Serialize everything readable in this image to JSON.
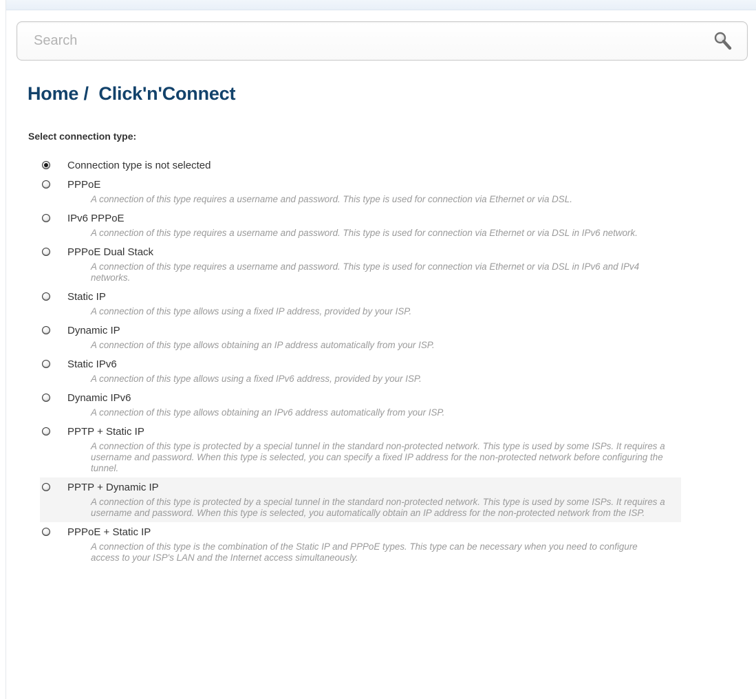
{
  "search": {
    "placeholder": "Search"
  },
  "breadcrumb": "Home /  Click'n'Connect",
  "section_label": "Select connection type:",
  "options": [
    {
      "label": "Connection type is not selected",
      "description": "",
      "checked": true
    },
    {
      "label": "PPPoE",
      "description": "A connection of this type requires a username and password. This type is used for connection via Ethernet or via DSL.",
      "checked": false
    },
    {
      "label": "IPv6 PPPoE",
      "description": "A connection of this type requires a username and password. This type is used for connection via Ethernet or via DSL in IPv6 network.",
      "checked": false
    },
    {
      "label": "PPPoE Dual Stack",
      "description": "A connection of this type requires a username and password. This type is used for connection via Ethernet or via DSL in IPv6 and IPv4 networks.",
      "checked": false
    },
    {
      "label": "Static IP",
      "description": "A connection of this type allows using a fixed IP address, provided by your ISP.",
      "checked": false
    },
    {
      "label": "Dynamic IP",
      "description": "A connection of this type allows obtaining an IP address automatically from your ISP.",
      "checked": false
    },
    {
      "label": "Static IPv6",
      "description": "A connection of this type allows using a fixed IPv6 address, provided by your ISP.",
      "checked": false
    },
    {
      "label": "Dynamic IPv6",
      "description": "A connection of this type allows obtaining an IPv6 address automatically from your ISP.",
      "checked": false
    },
    {
      "label": "PPTP + Static IP",
      "description": "A connection of this type is protected by a special tunnel in the standard non-protected network. This type is used by some ISPs. It requires a username and password. When this type is selected, you can specify a fixed IP address for the non-protected network before configuring the tunnel.",
      "checked": false
    },
    {
      "label": "PPTP + Dynamic IP",
      "description": "A connection of this type is protected by a special tunnel in the standard non-protected network. This type is used by some ISPs. It requires a username and password. When this type is selected, you automatically obtain an IP address for the non-protected network from the ISP.",
      "checked": false,
      "hovered": true
    },
    {
      "label": "PPPoE + Static IP",
      "description": "A connection of this type is the combination of the Static IP and PPPoE types. This type can be necessary when you need to configure access to your ISP's LAN and the Internet access simultaneously.",
      "checked": false
    }
  ],
  "icons": {
    "search": "magnifier-icon",
    "radio": "radio-button"
  },
  "colors": {
    "heading": "#12426b",
    "description": "#9a9a9a",
    "text": "#333333"
  }
}
